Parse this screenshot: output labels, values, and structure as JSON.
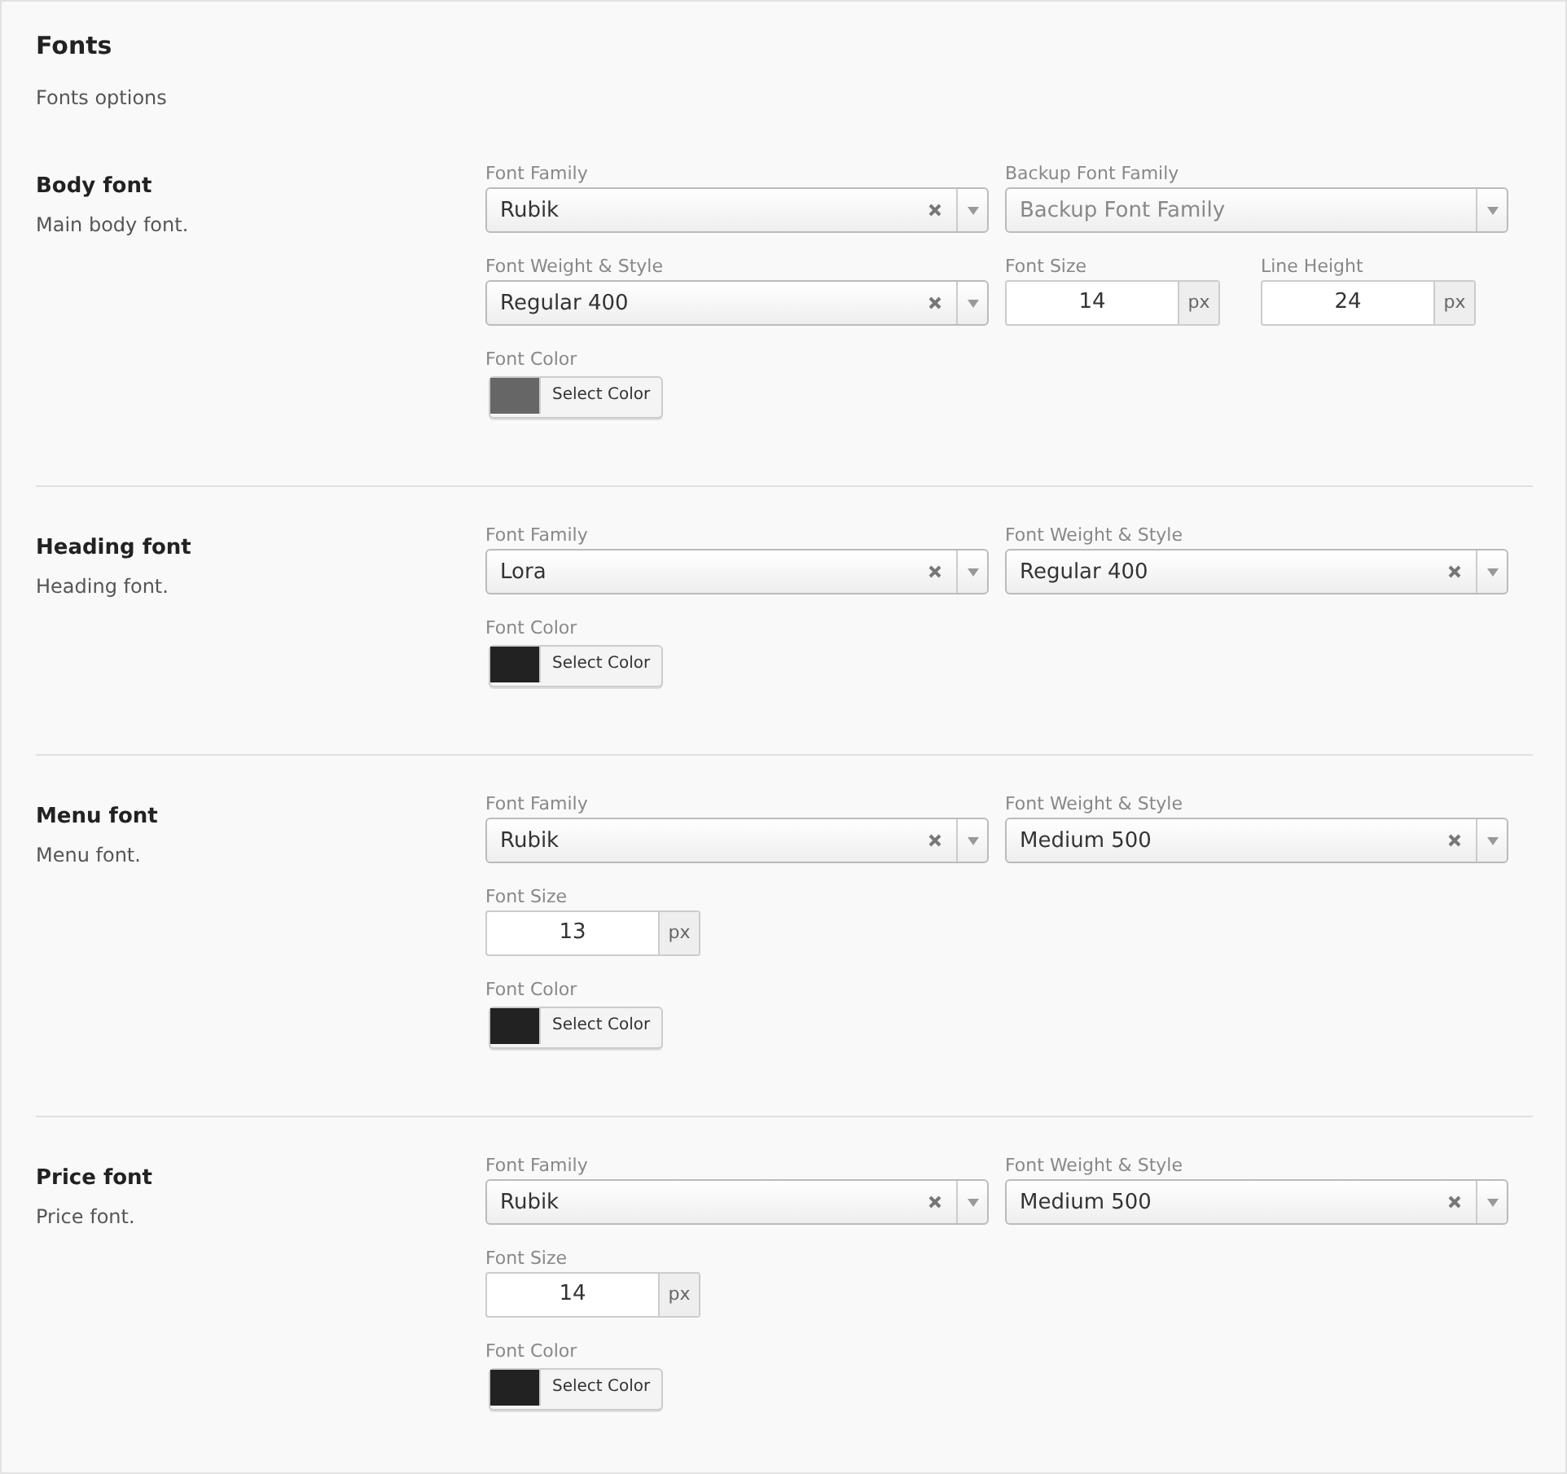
{
  "title": "Fonts",
  "subtitle": "Fonts options",
  "sections": [
    {
      "name": "Body font",
      "description": "Main body font.",
      "rows": [
        [
          {
            "kind": "select",
            "label": "Font Family",
            "value": "Rubik",
            "clearable": true
          },
          {
            "kind": "select",
            "label": "Backup Font Family",
            "placeholder": "Backup Font Family",
            "clearable": false
          }
        ],
        [
          {
            "kind": "select",
            "label": "Font Weight & Style",
            "value": "Regular 400",
            "clearable": true
          },
          {
            "kind": "number",
            "label": "Font Size",
            "value": "14",
            "unit": "px"
          },
          {
            "kind": "number",
            "label": "Line Height",
            "value": "24",
            "unit": "px"
          }
        ],
        [
          {
            "kind": "color",
            "label": "Font Color",
            "color": "#666666",
            "button": "Select Color"
          }
        ]
      ]
    },
    {
      "name": "Heading font",
      "description": "Heading font.",
      "rows": [
        [
          {
            "kind": "select",
            "label": "Font Family",
            "value": "Lora",
            "clearable": true
          },
          {
            "kind": "select",
            "label": "Font Weight & Style",
            "value": "Regular 400",
            "clearable": true
          }
        ],
        [
          {
            "kind": "color",
            "label": "Font Color",
            "color": "#222222",
            "button": "Select Color"
          }
        ]
      ]
    },
    {
      "name": "Menu font",
      "description": "Menu font.",
      "rows": [
        [
          {
            "kind": "select",
            "label": "Font Family",
            "value": "Rubik",
            "clearable": true
          },
          {
            "kind": "select",
            "label": "Font Weight & Style",
            "value": "Medium 500",
            "clearable": true
          }
        ],
        [
          {
            "kind": "number",
            "label": "Font Size",
            "value": "13",
            "unit": "px"
          }
        ],
        [
          {
            "kind": "color",
            "label": "Font Color",
            "color": "#222222",
            "button": "Select Color"
          }
        ]
      ]
    },
    {
      "name": "Price font",
      "description": "Price font.",
      "rows": [
        [
          {
            "kind": "select",
            "label": "Font Family",
            "value": "Rubik",
            "clearable": true
          },
          {
            "kind": "select",
            "label": "Font Weight & Style",
            "value": "Medium 500",
            "clearable": true
          }
        ],
        [
          {
            "kind": "number",
            "label": "Font Size",
            "value": "14",
            "unit": "px"
          }
        ],
        [
          {
            "kind": "color",
            "label": "Font Color",
            "color": "#222222",
            "button": "Select Color"
          }
        ]
      ]
    }
  ]
}
